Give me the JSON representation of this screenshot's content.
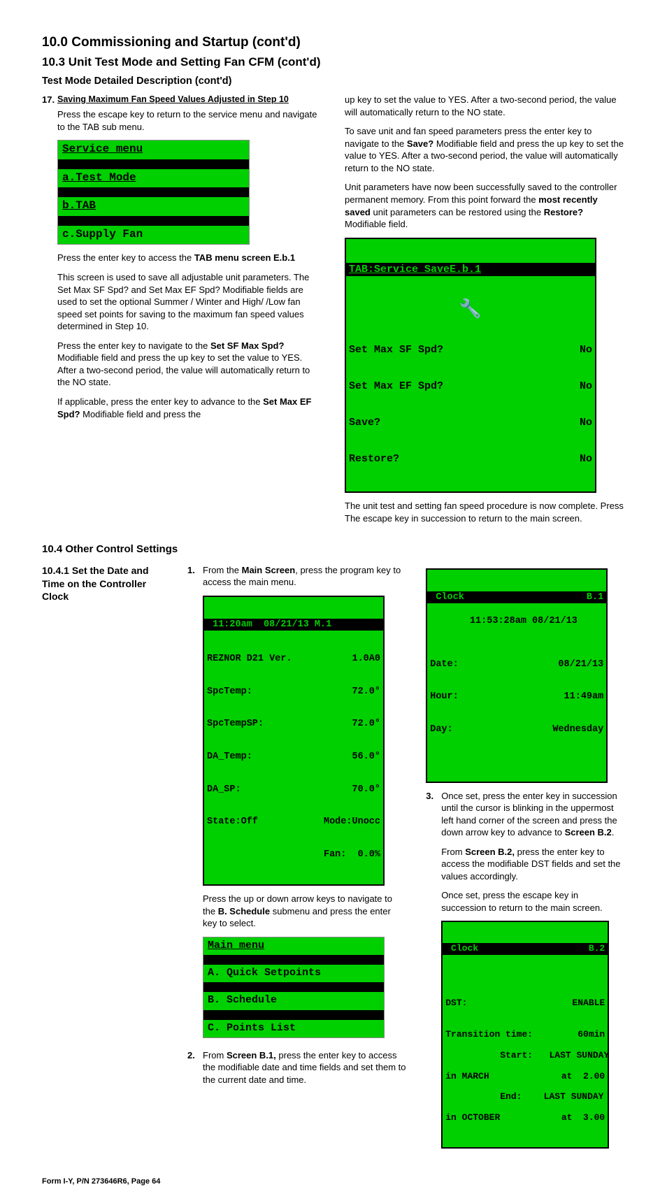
{
  "headings": {
    "h1": "10.0 Commissioning and Startup (cont'd)",
    "h2": "10.3 Unit Test Mode and Setting Fan CFM (cont'd)",
    "h3": "Test Mode Detailed Description (cont'd)",
    "step17_num": "17.",
    "step17": "Saving Maximum Fan Speed Values Adjusted in Step 10",
    "h4": "10.4 Other Control Settings",
    "h5": "10.4.1 Set the Date and Time on the Controller Clock"
  },
  "left": {
    "p1": "Press the escape key to return to the service menu and navigate to the TAB sub menu.",
    "menu1": {
      "title": "Service menu",
      "a": "a.Test Mode",
      "b": "b.TAB",
      "c": "c.Supply Fan"
    },
    "p2a": "Press the enter key to access the ",
    "p2b": "TAB menu screen E.b.1",
    "p3": "This screen is used to save all adjustable unit parameters. The Set Max SF Spd? and Set Max EF Spd? Modifiable fields are used to set the optional Summer / Winter and High/ /Low fan speed set points for saving to the maximum fan speed values determined in Step 10.",
    "p4a": "Press the enter key to navigate to the ",
    "p4b": "Set SF Max Spd?",
    "p4c": " Modifiable field and press the up key to set the value to YES. After a two-second period, the value will automatically return to the NO state.",
    "p5a": "If applicable, press the enter key to advance to the ",
    "p5b": "Set Max EF Spd?",
    "p5c": " Modifiable field and press the"
  },
  "right": {
    "p1": "up key to set the value to YES. After a two-second period, the value will automatically return to the NO state.",
    "p2a": "To save unit and fan speed parameters press the enter key to navigate to the ",
    "p2b": "Save?",
    "p2c": " Modifiable field and press the up key to set the value to YES. After a two-second period, the value will automatically return to the NO state.",
    "p3a": "Unit parameters have now been successfully saved to the controller permanent memory. From this point forward the ",
    "p3b": "most recently saved",
    "p3c": " unit parameters can be restored using the ",
    "p3d": "Restore?",
    "p3e": " Modifiable field.",
    "lcd": {
      "title": "TAB:Service SaveE.b.1",
      "r1l": "Set Max SF Spd?",
      "r1r": "No",
      "r2l": "Set Max EF Spd?",
      "r2r": "No",
      "r3l": "Save?",
      "r3r": "No",
      "r4l": "Restore?",
      "r4r": "No"
    },
    "p4": "The unit test and setting fan speed procedure is now complete. Press The escape key in succession to return to the main screen."
  },
  "mid": {
    "n1": "1.",
    "p1a": "From the ",
    "p1b": "Main Screen",
    "p1c": ", press the program key to access the main menu.",
    "lcd1": {
      "hdr": " 11:20am  08/21/13 M.1",
      "l1l": "REZNOR D21 Ver.",
      "l1r": "1.0A0",
      "l2l": "SpcTemp:",
      "l2r": "72.0°",
      "l3l": "SpcTempSP:",
      "l3r": "72.0°",
      "l4l": "DA_Temp:",
      "l4r": "56.0°",
      "l5l": "DA_SP:",
      "l5r": "70.0°",
      "l6l": "State:Off",
      "l6r": "Mode:Unocc",
      "l7r": "Fan:  0.0%"
    },
    "p2a": "Press the up or down arrow keys to navigate to the ",
    "p2b": "B. Schedule",
    "p2c": " submenu and press the enter key to select.",
    "menu2": {
      "title": "Main menu",
      "a": "A.  Quick Setpoints",
      "b": "B.  Schedule",
      "c": "C.  Points List"
    },
    "n2": "2.",
    "p3a": "From ",
    "p3b": "Screen B.1,",
    "p3c": " press the enter key to access the modifiable date and time fields and set them to the current date and time."
  },
  "rlow": {
    "lcd1": {
      "hdrL": " Clock",
      "hdrR": "B.1",
      "t": " 11:53:28am 08/21/13",
      "r1l": "Date:",
      "r1r": "08/21/13",
      "r2l": "Hour:",
      "r2r": "11:49am",
      "r3l": "Day:",
      "r3r": "Wednesday"
    },
    "n3": "3.",
    "p1a": "Once set, press the enter key in succession until the cursor is blinking in the uppermost left hand corner of the screen and press the down arrow key to advance to ",
    "p1b": "Screen B.2",
    "p1c": ".",
    "p2a": "From ",
    "p2b": "Screen B.2,",
    "p2c": " press the enter key to access the modifiable DST fields and set the values accordingly.",
    "p3": "Once set, press the escape key in succession to return to the main screen.",
    "lcd2": {
      "hdrL": " Clock",
      "hdrR": "B.2",
      "l1l": "DST:",
      "l1r": "ENABLE",
      "l2l": "Transition time:",
      "l2r": "60min",
      "l3": "Start:   LAST SUNDAY",
      "l4l": "in MARCH",
      "l4r": "at  2.00",
      "l5": "End:    LAST SUNDAY",
      "l6l": "in OCTOBER",
      "l6r": "at  3.00"
    }
  },
  "footer": "Form I-Y, P/N 273646R6, Page 64"
}
